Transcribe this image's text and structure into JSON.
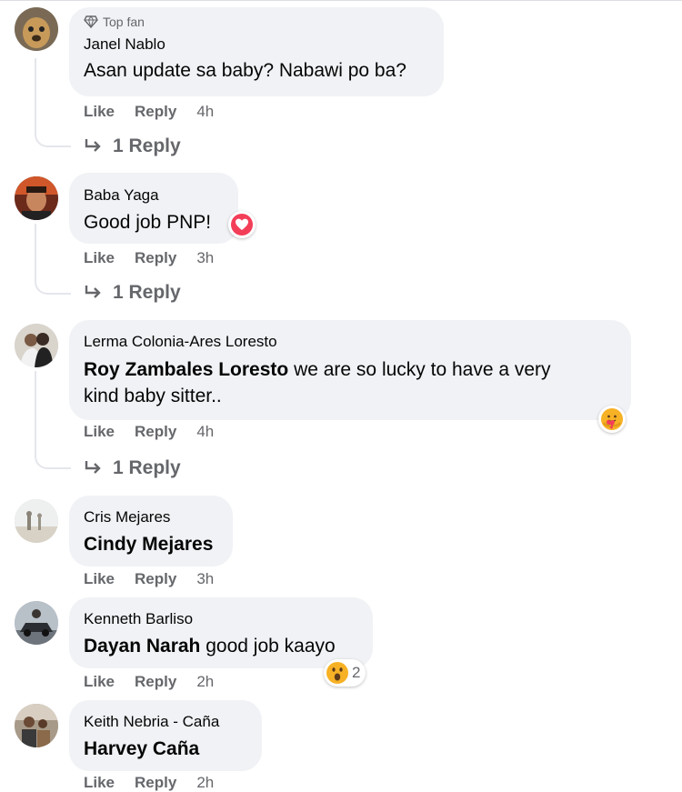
{
  "actions": {
    "like": "Like",
    "reply": "Reply"
  },
  "comments": [
    {
      "badge": "Top fan",
      "author": "Janel Nablo",
      "mention": "",
      "text": "Asan update sa baby? Nabawi po ba?",
      "time": "4h",
      "replies": "1 Reply"
    },
    {
      "author": "Baba Yaga",
      "mention": "",
      "text": "Good job PNP!",
      "time": "3h",
      "replies": "1 Reply",
      "reaction": "love-icon"
    },
    {
      "author": "Lerma Colonia-Ares Loresto",
      "mention": "Roy Zambales Loresto",
      "text_line1": " we are so lucky to have a very",
      "text_line2": "kind baby sitter..",
      "time": "4h",
      "replies": "1 Reply",
      "reaction": "care-icon"
    },
    {
      "author": "Cris Mejares",
      "mention": "Cindy Mejares",
      "text": "",
      "time": "3h"
    },
    {
      "author": "Kenneth Barliso",
      "mention": "Dayan Narah",
      "text": " good job kaayo",
      "time": "2h",
      "reaction": "wow-icon",
      "reaction_count": "2"
    },
    {
      "author": "Keith Nebria - Caña",
      "mention": "Harvey Caña",
      "text": "",
      "time": "2h"
    }
  ],
  "colors": {
    "bubble": "#f0f2f5",
    "secondary_text": "#65676b",
    "love": "#f33e58",
    "reaction_yellow": "#f7b125"
  }
}
